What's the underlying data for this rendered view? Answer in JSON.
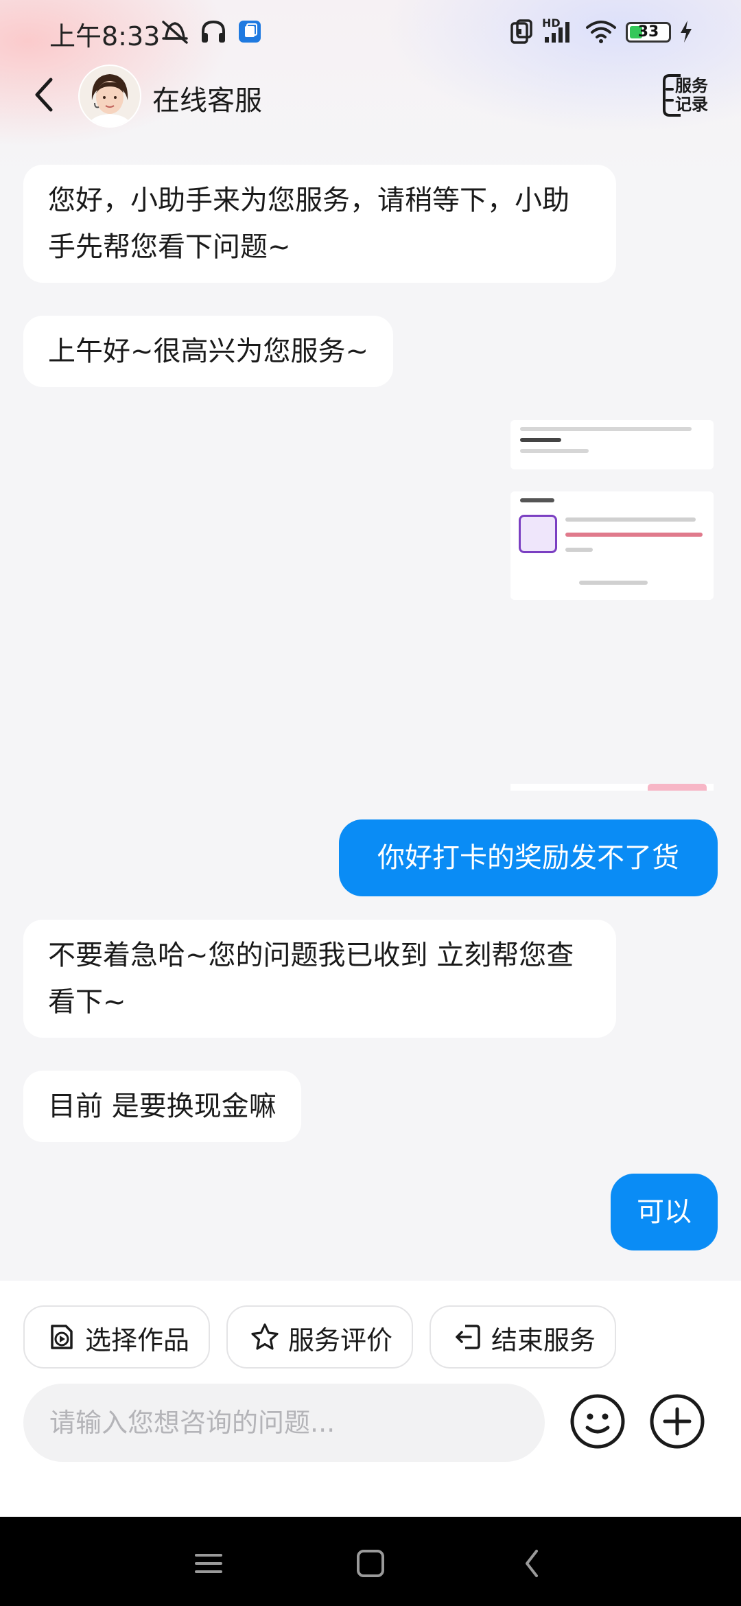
{
  "status_bar": {
    "time": "上午8:33",
    "network_label": "HD",
    "battery_level": "33",
    "battery_fraction": 0.33,
    "icons": [
      "alarm-off-icon",
      "headset-icon",
      "app-notification-icon",
      "nfc-icon",
      "signal-icon",
      "wifi-icon",
      "battery-icon",
      "charging-icon"
    ]
  },
  "header": {
    "title": "在线客服",
    "records_label": "服务记录",
    "back_icon": "chevron-left-icon",
    "avatar": "agent-avatar"
  },
  "messages": [
    {
      "side": "left",
      "text": "您好，小助手来为您服务，请稍等下，小助手先帮您看下问题~"
    },
    {
      "side": "left",
      "text": "上午好~很高兴为您服务~"
    },
    {
      "side": "right",
      "type": "shared-card"
    },
    {
      "side": "right",
      "text": "你好打卡的奖励发不了货"
    },
    {
      "side": "left",
      "text": "不要着急哈~您的问题我已收到 立刻帮您查看下~"
    },
    {
      "side": "left",
      "text": "目前 是要换现金嘛"
    },
    {
      "side": "right",
      "text": "可以"
    }
  ],
  "actions": [
    {
      "label": "选择作品",
      "icon": "video-select-icon"
    },
    {
      "label": "服务评价",
      "icon": "star-icon"
    },
    {
      "label": "结束服务",
      "icon": "exit-icon"
    }
  ],
  "composer": {
    "placeholder": "请输入您想咨询的问题...",
    "value": "",
    "emoji_icon": "emoji-icon",
    "add_icon": "plus-circle-icon"
  },
  "nav_bar": {
    "icons": [
      "menu-icon",
      "home-square-icon",
      "back-triangle-icon"
    ]
  },
  "colors": {
    "accent": "#0a8cf5",
    "background": "#f5f5f7",
    "bubble_left": "#ffffff",
    "nav_bar": "#000000"
  }
}
